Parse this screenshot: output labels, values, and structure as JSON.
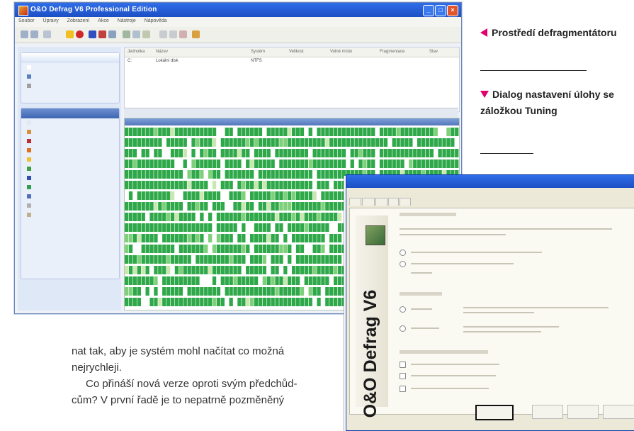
{
  "defrag_window": {
    "title": "O&O Defrag V6 Professional Edition",
    "menu": [
      "Soubor",
      "Úpravy",
      "Zobrazení",
      "Akce",
      "Nástroje",
      "Nápověda"
    ],
    "list_headers": [
      "Jednotka",
      "Název",
      "Systém",
      "Velikost",
      "Volné místo",
      "Fragmentace",
      "Stav"
    ],
    "list_row": [
      "C:",
      "Lokální disk",
      "NTFS",
      "",
      "",
      "",
      ""
    ]
  },
  "captions": {
    "first": "Prostředí defragmentátoru",
    "second": "Dialog nastavení úlohy se záložkou Tuning"
  },
  "body_text": {
    "line1": "nat tak, aby je systém mohl načítat co možná",
    "line2": "nejrychleji.",
    "line3": "Co přináší nová verze oproti svým předchůd-",
    "line4": "cům? V první řadě je to nepatrně pozměněný"
  },
  "dialog": {
    "brand": "O&O Defrag V6",
    "accent": "#e0006e",
    "map_green": "#2fa84a"
  }
}
